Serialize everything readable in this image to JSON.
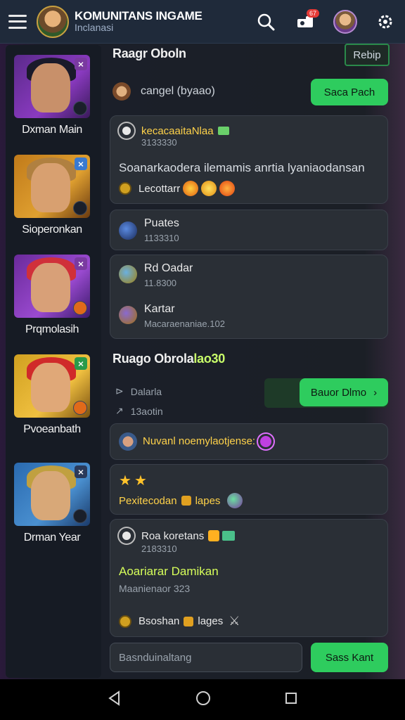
{
  "topbar": {
    "title": "KOMUNITANS INGAME",
    "subtitle": "Inclanasi",
    "notification_count": "67"
  },
  "sidebar": {
    "heroes": [
      {
        "name": "Dxman Main",
        "corner": "⨯"
      },
      {
        "name": "Sioperonkan",
        "corner": "⨯"
      },
      {
        "name": "Prqmolasih",
        "corner": "⨯"
      },
      {
        "name": "Pvoeanbath",
        "corner": "⨯"
      },
      {
        "name": "Drman Year",
        "corner": "⨯"
      }
    ]
  },
  "main": {
    "section1_title": "Raagr Oboln",
    "section1_button": "Rebip",
    "search_row": {
      "text": "cangel (byaao)",
      "button": "Saca Pach"
    },
    "card1": {
      "header": "kecacaaitaNlaa",
      "id": "3133330",
      "body": "Soanarkaodera ilemamis anrtia lyaniaodansan",
      "footer": "Lecottarr"
    },
    "card2": {
      "title": "Puates",
      "sub": "1133310"
    },
    "card3": {
      "item1_title": "Rd Oadar",
      "item1_sub": "11.8300",
      "item2_title": "Kartar",
      "item2_sub": "Macaraenaniae.102"
    },
    "section2_title_main": "Ruago Obrola",
    "section2_title_accent": "lao30",
    "stat1": "Dalarla",
    "stat2": "13aotin",
    "section2_button": "Bauor Dlmo",
    "msg1": "Nuvanl noemylaotjense:",
    "msg2_text": "Pexitecodan",
    "msg2_tag": "lapes",
    "card4": {
      "header": "Roa koretans",
      "id": "2183310",
      "title": "Aoariarar Damikan",
      "sub": "Maanienaor 323",
      "footer_text": "Bsoshan",
      "footer_tag": "lages"
    },
    "input_placeholder": "Basnduinaltang",
    "send_button": "Sass Kant"
  },
  "colors": {
    "accent_green": "#2ecc5e",
    "topbar_bg": "#1f2a3a",
    "panel_bg": "#2a2f36",
    "highlight_yellow": "#ffd24a",
    "highlight_lime": "#d7ff5a"
  }
}
